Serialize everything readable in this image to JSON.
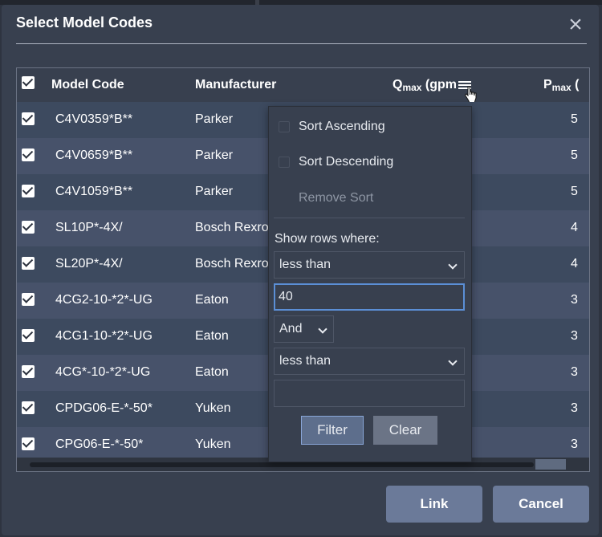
{
  "dialog": {
    "title": "Select Model Codes",
    "close_label": "×"
  },
  "grid": {
    "columns": {
      "model_code": "Model Code",
      "manufacturer": "Manufacturer",
      "qmax_main": "Q",
      "qmax_sub": "max",
      "qmax_unit": " (gpm",
      "pmax_main": "P",
      "pmax_sub": "max",
      "pmax_unit": " ("
    },
    "header_checkbox_checked": true,
    "rows": [
      {
        "checked": true,
        "model_code": "C4V0359*B**",
        "manufacturer": "Parker",
        "pmax": "5"
      },
      {
        "checked": true,
        "model_code": "C4V0659*B**",
        "manufacturer": "Parker",
        "pmax": "5"
      },
      {
        "checked": true,
        "model_code": "C4V1059*B**",
        "manufacturer": "Parker",
        "pmax": "5"
      },
      {
        "checked": true,
        "model_code": "SL10P*-4X/",
        "manufacturer": "Bosch Rexroth",
        "pmax": "4"
      },
      {
        "checked": true,
        "model_code": "SL20P*-4X/",
        "manufacturer": "Bosch Rexroth",
        "pmax": "4"
      },
      {
        "checked": true,
        "model_code": "4CG2-10-*2*-UG",
        "manufacturer": "Eaton",
        "pmax": "3"
      },
      {
        "checked": true,
        "model_code": "4CG1-10-*2*-UG",
        "manufacturer": "Eaton",
        "pmax": "3"
      },
      {
        "checked": true,
        "model_code": "4CG*-10-*2*-UG",
        "manufacturer": "Eaton",
        "pmax": "3"
      },
      {
        "checked": true,
        "model_code": "CPDG06-E-*-50*",
        "manufacturer": "Yuken",
        "pmax": "3"
      },
      {
        "checked": true,
        "model_code": "CPG06-E-*-50*",
        "manufacturer": "Yuken",
        "pmax": "3"
      }
    ]
  },
  "column_menu": {
    "sort_ascending": "Sort Ascending",
    "sort_descending": "Sort Descending",
    "remove_sort": "Remove Sort",
    "show_rows_where": "Show rows where:",
    "condition1": "less than",
    "value1": "40",
    "logic": "And",
    "condition2": "less than",
    "value2": "",
    "filter_label": "Filter",
    "clear_label": "Clear"
  },
  "footer": {
    "link_label": "Link",
    "cancel_label": "Cancel"
  },
  "colors": {
    "background": "#2e3440",
    "dialog": "#38404f",
    "row_odd": "#3d4a5f",
    "row_even": "#47526a",
    "button": "#6b7a99",
    "filter_border": "#89a6d8"
  },
  "icons": [
    "close-icon",
    "column-menu-icon",
    "hand-cursor-icon",
    "chevron-down-icon",
    "checkbox-checked-icon"
  ]
}
